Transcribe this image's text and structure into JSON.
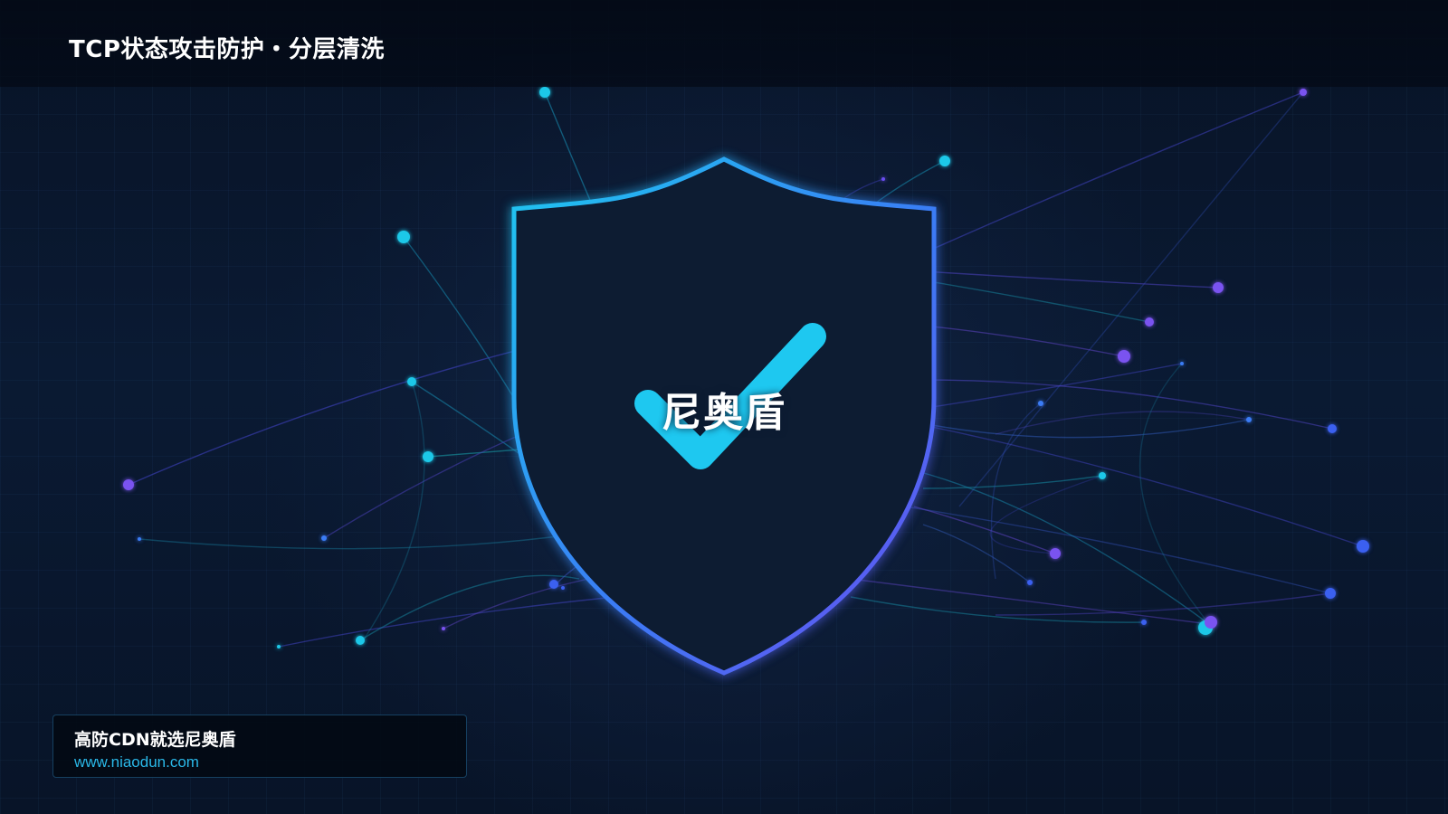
{
  "header": {
    "title": "TCP状态攻击防护・分层清洗"
  },
  "center": {
    "brand": "尼奥盾"
  },
  "footer": {
    "slogan": "高防CDN就选尼奥盾",
    "url": "www.niaodun.com"
  },
  "colors": {
    "background": "#081326",
    "accent_cyan": "#1ec8f0",
    "accent_blue": "#3a7cf5",
    "accent_violet": "#6a4ef0",
    "shield_fill": "#0c1a33",
    "url_text": "#2ab8e8"
  },
  "icons": {
    "shield": "shield-icon",
    "check": "check-icon"
  }
}
